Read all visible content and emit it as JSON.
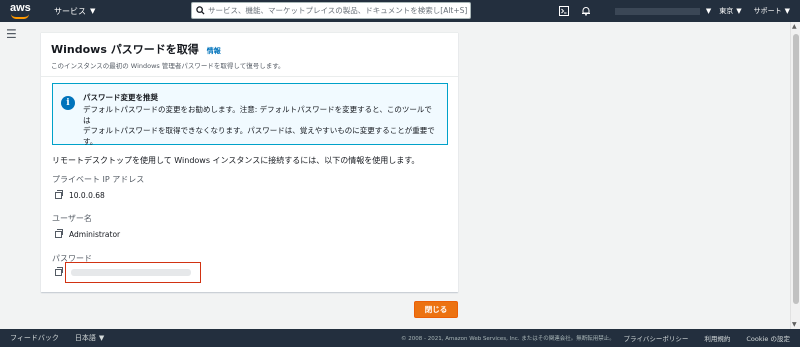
{
  "topnav": {
    "logo_text": "aws",
    "services_label": "サービス",
    "search_placeholder": "サービス、機能、マーケットプレイスの製品、ドキュメントを検索し[Alt+S]",
    "region_label": "東京",
    "support_label": "サポート",
    "icons": [
      "cloudshell-icon",
      "bell-icon"
    ]
  },
  "card": {
    "title": "Windows パスワードを取得",
    "info_link": "情報",
    "description": "このインスタンスの最初の Windows 管理者パスワードを取得して復号します。",
    "alert": {
      "title": "パスワード変更を推奨",
      "body_line1": "デフォルトパスワードの変更をお勧めします。注意: デフォルトパスワードを変更すると、このツールでは",
      "body_line2": "デフォルトパスワードを取得できなくなります。パスワードは、覚えやすいものに変更することが重要で",
      "body_line3": "す。"
    },
    "intro_text": "リモートデスクトップを使用して Windows インスタンスに接続するには、以下の情報を使用します。",
    "fields": [
      {
        "label": "プライベート IP アドレス",
        "value": "10.0.0.68"
      },
      {
        "label": "ユーザー名",
        "value": "Administrator"
      },
      {
        "label": "パスワード",
        "value": ""
      }
    ]
  },
  "actions": {
    "close_label": "閉じる"
  },
  "footer": {
    "feedback": "フィードバック",
    "language": "日本語",
    "copyright": "© 2008 - 2021, Amazon Web Services, Inc. またはその関連会社。無断転用禁止。",
    "links": [
      "プライバシーポリシー",
      "利用規約",
      "Cookie の設定"
    ]
  },
  "colors": {
    "nav_bg": "#232f3e",
    "accent": "#ec7211",
    "link": "#0073bb",
    "alert_border": "#00a1c9",
    "highlight": "#d13212"
  }
}
